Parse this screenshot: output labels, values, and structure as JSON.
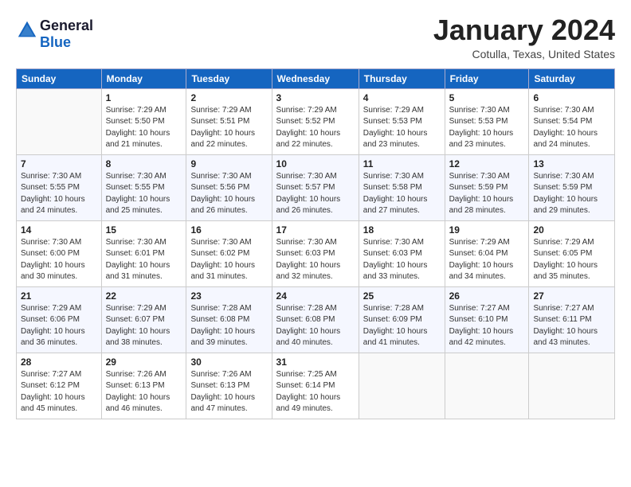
{
  "logo": {
    "line1": "General",
    "line2": "Blue"
  },
  "title": "January 2024",
  "subtitle": "Cotulla, Texas, United States",
  "days_of_week": [
    "Sunday",
    "Monday",
    "Tuesday",
    "Wednesday",
    "Thursday",
    "Friday",
    "Saturday"
  ],
  "weeks": [
    [
      {
        "day": "",
        "sunrise": "",
        "sunset": "",
        "daylight": ""
      },
      {
        "day": "1",
        "sunrise": "Sunrise: 7:29 AM",
        "sunset": "Sunset: 5:50 PM",
        "daylight": "Daylight: 10 hours and 21 minutes."
      },
      {
        "day": "2",
        "sunrise": "Sunrise: 7:29 AM",
        "sunset": "Sunset: 5:51 PM",
        "daylight": "Daylight: 10 hours and 22 minutes."
      },
      {
        "day": "3",
        "sunrise": "Sunrise: 7:29 AM",
        "sunset": "Sunset: 5:52 PM",
        "daylight": "Daylight: 10 hours and 22 minutes."
      },
      {
        "day": "4",
        "sunrise": "Sunrise: 7:29 AM",
        "sunset": "Sunset: 5:53 PM",
        "daylight": "Daylight: 10 hours and 23 minutes."
      },
      {
        "day": "5",
        "sunrise": "Sunrise: 7:30 AM",
        "sunset": "Sunset: 5:53 PM",
        "daylight": "Daylight: 10 hours and 23 minutes."
      },
      {
        "day": "6",
        "sunrise": "Sunrise: 7:30 AM",
        "sunset": "Sunset: 5:54 PM",
        "daylight": "Daylight: 10 hours and 24 minutes."
      }
    ],
    [
      {
        "day": "7",
        "sunrise": "Sunrise: 7:30 AM",
        "sunset": "Sunset: 5:55 PM",
        "daylight": "Daylight: 10 hours and 24 minutes."
      },
      {
        "day": "8",
        "sunrise": "Sunrise: 7:30 AM",
        "sunset": "Sunset: 5:55 PM",
        "daylight": "Daylight: 10 hours and 25 minutes."
      },
      {
        "day": "9",
        "sunrise": "Sunrise: 7:30 AM",
        "sunset": "Sunset: 5:56 PM",
        "daylight": "Daylight: 10 hours and 26 minutes."
      },
      {
        "day": "10",
        "sunrise": "Sunrise: 7:30 AM",
        "sunset": "Sunset: 5:57 PM",
        "daylight": "Daylight: 10 hours and 26 minutes."
      },
      {
        "day": "11",
        "sunrise": "Sunrise: 7:30 AM",
        "sunset": "Sunset: 5:58 PM",
        "daylight": "Daylight: 10 hours and 27 minutes."
      },
      {
        "day": "12",
        "sunrise": "Sunrise: 7:30 AM",
        "sunset": "Sunset: 5:59 PM",
        "daylight": "Daylight: 10 hours and 28 minutes."
      },
      {
        "day": "13",
        "sunrise": "Sunrise: 7:30 AM",
        "sunset": "Sunset: 5:59 PM",
        "daylight": "Daylight: 10 hours and 29 minutes."
      }
    ],
    [
      {
        "day": "14",
        "sunrise": "Sunrise: 7:30 AM",
        "sunset": "Sunset: 6:00 PM",
        "daylight": "Daylight: 10 hours and 30 minutes."
      },
      {
        "day": "15",
        "sunrise": "Sunrise: 7:30 AM",
        "sunset": "Sunset: 6:01 PM",
        "daylight": "Daylight: 10 hours and 31 minutes."
      },
      {
        "day": "16",
        "sunrise": "Sunrise: 7:30 AM",
        "sunset": "Sunset: 6:02 PM",
        "daylight": "Daylight: 10 hours and 31 minutes."
      },
      {
        "day": "17",
        "sunrise": "Sunrise: 7:30 AM",
        "sunset": "Sunset: 6:03 PM",
        "daylight": "Daylight: 10 hours and 32 minutes."
      },
      {
        "day": "18",
        "sunrise": "Sunrise: 7:30 AM",
        "sunset": "Sunset: 6:03 PM",
        "daylight": "Daylight: 10 hours and 33 minutes."
      },
      {
        "day": "19",
        "sunrise": "Sunrise: 7:29 AM",
        "sunset": "Sunset: 6:04 PM",
        "daylight": "Daylight: 10 hours and 34 minutes."
      },
      {
        "day": "20",
        "sunrise": "Sunrise: 7:29 AM",
        "sunset": "Sunset: 6:05 PM",
        "daylight": "Daylight: 10 hours and 35 minutes."
      }
    ],
    [
      {
        "day": "21",
        "sunrise": "Sunrise: 7:29 AM",
        "sunset": "Sunset: 6:06 PM",
        "daylight": "Daylight: 10 hours and 36 minutes."
      },
      {
        "day": "22",
        "sunrise": "Sunrise: 7:29 AM",
        "sunset": "Sunset: 6:07 PM",
        "daylight": "Daylight: 10 hours and 38 minutes."
      },
      {
        "day": "23",
        "sunrise": "Sunrise: 7:28 AM",
        "sunset": "Sunset: 6:08 PM",
        "daylight": "Daylight: 10 hours and 39 minutes."
      },
      {
        "day": "24",
        "sunrise": "Sunrise: 7:28 AM",
        "sunset": "Sunset: 6:08 PM",
        "daylight": "Daylight: 10 hours and 40 minutes."
      },
      {
        "day": "25",
        "sunrise": "Sunrise: 7:28 AM",
        "sunset": "Sunset: 6:09 PM",
        "daylight": "Daylight: 10 hours and 41 minutes."
      },
      {
        "day": "26",
        "sunrise": "Sunrise: 7:27 AM",
        "sunset": "Sunset: 6:10 PM",
        "daylight": "Daylight: 10 hours and 42 minutes."
      },
      {
        "day": "27",
        "sunrise": "Sunrise: 7:27 AM",
        "sunset": "Sunset: 6:11 PM",
        "daylight": "Daylight: 10 hours and 43 minutes."
      }
    ],
    [
      {
        "day": "28",
        "sunrise": "Sunrise: 7:27 AM",
        "sunset": "Sunset: 6:12 PM",
        "daylight": "Daylight: 10 hours and 45 minutes."
      },
      {
        "day": "29",
        "sunrise": "Sunrise: 7:26 AM",
        "sunset": "Sunset: 6:13 PM",
        "daylight": "Daylight: 10 hours and 46 minutes."
      },
      {
        "day": "30",
        "sunrise": "Sunrise: 7:26 AM",
        "sunset": "Sunset: 6:13 PM",
        "daylight": "Daylight: 10 hours and 47 minutes."
      },
      {
        "day": "31",
        "sunrise": "Sunrise: 7:25 AM",
        "sunset": "Sunset: 6:14 PM",
        "daylight": "Daylight: 10 hours and 49 minutes."
      },
      {
        "day": "",
        "sunrise": "",
        "sunset": "",
        "daylight": ""
      },
      {
        "day": "",
        "sunrise": "",
        "sunset": "",
        "daylight": ""
      },
      {
        "day": "",
        "sunrise": "",
        "sunset": "",
        "daylight": ""
      }
    ]
  ]
}
